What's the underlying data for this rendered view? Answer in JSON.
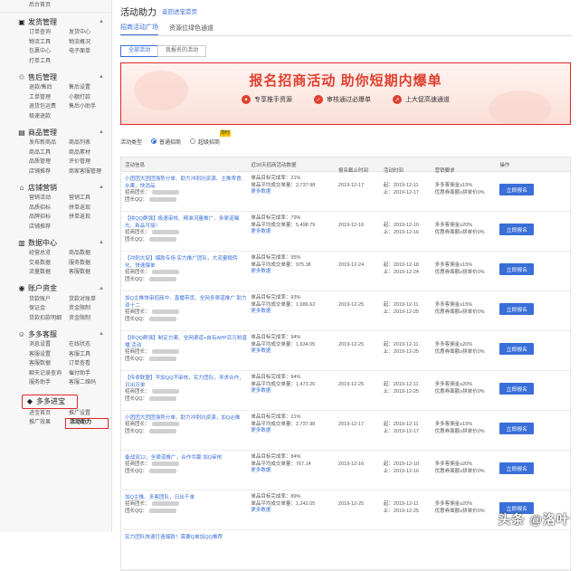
{
  "sidebar": {
    "home": "后台首页",
    "sections": [
      {
        "title": "发货管理",
        "icon": "truck-icon",
        "items": [
          "订单查询",
          "发货中心",
          "物流工具",
          "物流概况",
          "包裹中心",
          "电子面单",
          "打单工具"
        ]
      },
      {
        "title": "售后管理",
        "icon": "service-icon",
        "items": [
          "退款/售后",
          "售后设置",
          "工单管理",
          "小额打款",
          "退货包运费",
          "售后小助手",
          "极速退款"
        ]
      },
      {
        "title": "商品管理",
        "icon": "goods-icon",
        "items": [
          "发布新商品",
          "商品列表",
          "商品工具",
          "商品素材",
          "品质管理",
          "评价管理",
          "店铺推荐",
          "商家客服管理"
        ]
      },
      {
        "title": "店铺营销",
        "icon": "store-icon",
        "items": [
          "营销活动",
          "营销工具",
          "品质招标",
          "拼单返现",
          "品牌招标",
          "拼单返现",
          "店铺推荐"
        ]
      },
      {
        "title": "数据中心",
        "icon": "chart-icon",
        "items": [
          "经营总览",
          "商品数据",
          "交易数据",
          "服务数据",
          "流量数据",
          "客服数据"
        ]
      },
      {
        "title": "账户资金",
        "icon": "wallet-icon",
        "items": [
          "货款账户",
          "货款对账单",
          "保证金",
          "资金限制",
          "货款扣款明细",
          "资金限制"
        ]
      },
      {
        "title": "多多客服",
        "icon": "chat-icon",
        "items": [
          "消息设置",
          "在线状态",
          "客服设置",
          "客服工具",
          "客服数据",
          "订单查看",
          "聊天记录查询",
          "催付助手",
          "服务助手",
          "客服二维码"
        ]
      }
    ],
    "last_section": {
      "title": "多多进宝",
      "icon": "gem-icon",
      "items": [
        "进宝首页",
        "推广设置",
        "推广效果",
        "活动助力"
      ],
      "active": "活动助力"
    }
  },
  "main": {
    "title": "活动助力",
    "back_link": "返回进宝首页",
    "tabs": [
      "招商活动广场",
      "资源位绿色通道"
    ],
    "subtabs": [
      "全部活动",
      "我报名的活动"
    ],
    "banner": {
      "headline": "报名招商活动 助你短期内爆单",
      "features": [
        "专享推手资源",
        "审核通过必爆单",
        "上大促高速通道"
      ]
    },
    "filter": {
      "label": "活动类型",
      "options": [
        "普通招商",
        "超级招商"
      ],
      "badge": "限时"
    },
    "table": {
      "headers": [
        "活动信息",
        "近30天招商活动数据",
        "报名截止时间",
        "活动时间",
        "营销要求",
        "操作"
      ],
      "rows": [
        {
          "title": "小团团大团团强势分单、助力冲刺坑资源、主推零食、水果、快消品",
          "l1": "招商团长：",
          "l2": "团长QQ：",
          "d1": "单品目标完成率：21%",
          "d2": "单品平均成交单量：2,737.98",
          "d3": "更多数据",
          "deadline": "2019-12-17",
          "s": "起：2019-12-11",
          "e": "止：2019-12-17",
          "r1": "多多客佣金≥15%",
          "r2": "优惠券面额≥拼单价0%",
          "btn": "立即报名"
        },
        {
          "title": "【拼QQ群强】极速审核、精准流量推广、多渠道曝光、新品可接！",
          "l1": "招商团长：",
          "l2": "团长QQ：",
          "d1": "单品目标完成率：79%",
          "d2": "单品平均成交单量：5,498.79",
          "d3": "更多数据",
          "deadline": "2019-12-16",
          "s": "起：2019-12-10",
          "e": "止：2019-12-16",
          "r1": "多多客佣金≥20%",
          "r2": "优惠券面额≥拼单价0%",
          "btn": "立即报名"
        },
        {
          "title": "【冲刺大促】爆款专场 实力推广团队，大流量稳转化，快速爆单",
          "l1": "招商团长：",
          "l2": "团长QQ：",
          "d1": "单品目标完成率：95%",
          "d2": "单品平均成交单量：975.38",
          "d3": "更多数据",
          "deadline": "2019-12-24",
          "s": "起：2019-12-18",
          "e": "止：2019-12-24",
          "r1": "多多客佣金≥15%",
          "r2": "优惠券面额≥拼单价0%",
          "btn": "立即报名"
        },
        {
          "title": "加Q主推快审招商中、直播带货、全网多渠道推广 助力双十二",
          "l1": "招商团长：",
          "l2": "团长QQ：",
          "d1": "单品目标完成率：93%",
          "d2": "单品平均成交单量：1,686.62",
          "d3": "更多数据",
          "deadline": "2019-12-25",
          "s": "起：2019-12-11",
          "e": "止：2019-12-25",
          "r1": "多多客佣金≥15%",
          "r2": "优惠券面额≥拼单价0%",
          "btn": "立即报名"
        },
        {
          "title": "【拼QQ群强】制定方案、全网渠道+自有APP百万粉直播 活动",
          "l1": "招商团长：",
          "l2": "团长QQ：",
          "d1": "单品目标完成率：94%",
          "d2": "单品平均成交单量：1,634.05",
          "d3": "更多数据",
          "deadline": "2019-12-25",
          "s": "起：2019-12-11",
          "e": "止：2019-12-25",
          "r1": "多多客佣金≥20%",
          "r2": "优惠券面额≥拼单价0%",
          "btn": "立即报名"
        },
        {
          "title": "【传奇联盟】不加QQ不审核，实力团队，寻求合作，日出万单",
          "l1": "招商团长：",
          "l2": "团长QQ：",
          "d1": "单品目标完成率：94%",
          "d2": "单品平均成交单量：1,473.26",
          "d3": "更多数据",
          "deadline": "2019-12-25",
          "s": "起：2019-12-11",
          "e": "止：2019-12-25",
          "r1": "多多客佣金≥20%",
          "r2": "优惠券面额≥拼单价0%",
          "btn": "立即报名"
        },
        {
          "title": "小团团大团团强势分单、助力冲刺坑资源，加Q必推",
          "l1": "招商团长：",
          "l2": "团长QQ：",
          "d1": "单品目标完成率：21%",
          "d2": "单品平均成交单量：2,737.98",
          "d3": "更多数据",
          "deadline": "2019-12-17",
          "s": "起：2019-12-11",
          "e": "止：2019-12-17",
          "r1": "多多客佣金≥15%",
          "r2": "优惠券面额≥拼单价0%",
          "btn": "立即报名"
        },
        {
          "title": "备战双12，全渠道推广，合作共赢 加Q审核",
          "l1": "招商团长：",
          "l2": "团长QQ：",
          "d1": "单品目标完成率：84%",
          "d2": "单品平均成交单量：767.14",
          "d3": "更多数据",
          "deadline": "2019-12-16",
          "s": "起：2019-12-10",
          "e": "止：2019-12-16",
          "r1": "多多客佣金≥20%",
          "r2": "优惠券面额≥拼单价0%",
          "btn": "立即报名"
        },
        {
          "title": "加Q主推、多客团队，日出千单",
          "l1": "招商团长：",
          "l2": "团长QQ：",
          "d1": "单品目标完成率：89%",
          "d2": "单品平均成交单量：1,242.05",
          "d3": "更多数据",
          "deadline": "2019-12-25",
          "s": "起：2019-12-11",
          "e": "止：2019-12-25",
          "r1": "多多客佣金≥20%",
          "r2": "优惠券面额≥拼单价0%",
          "btn": "立即报名"
        },
        {
          "title": "实力团队快速打造爆款！需要Q单加QQ推荐",
          "l1": "",
          "l2": "",
          "d1": "",
          "d2": "",
          "d3": "",
          "deadline": "",
          "s": "",
          "e": "",
          "r1": "",
          "r2": "",
          "btn": ""
        }
      ]
    }
  },
  "watermark": "头条 @洛叶"
}
